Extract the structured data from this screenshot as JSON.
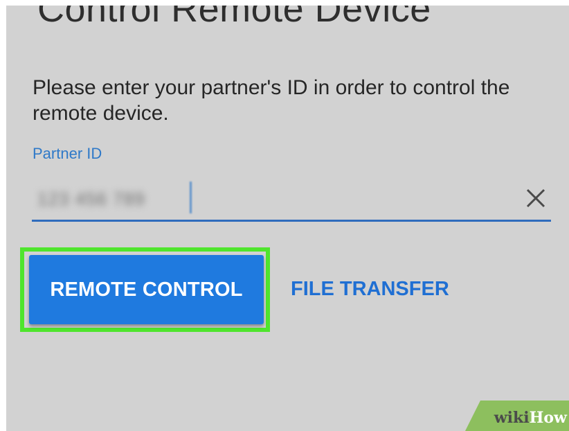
{
  "screen": {
    "title": "Control Remote Device",
    "instruction": "Please enter your partner's ID in order to control the remote device."
  },
  "partner_field": {
    "label": "Partner ID",
    "value": "123 456 789",
    "value_blurred": true,
    "clear_icon": "close-icon"
  },
  "actions": {
    "remote_control_label": "REMOTE CONTROL",
    "file_transfer_label": "FILE TRANSFER"
  },
  "watermark": {
    "part1": "wiki",
    "part2": "How"
  },
  "colors": {
    "background": "#d2d2d2",
    "accent_blue": "#1f7adf",
    "label_blue": "#2f79c8",
    "highlight_green": "#4fe52d",
    "watermark_green": "#8dbf5e"
  }
}
